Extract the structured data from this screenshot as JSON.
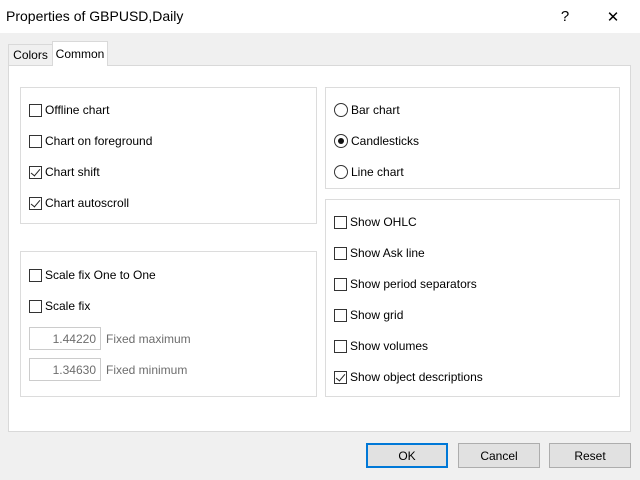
{
  "window": {
    "title": "Properties of GBPUSD,Daily",
    "help_glyph": "?",
    "close_glyph": "✕"
  },
  "tabs": [
    {
      "label": "Colors",
      "active": false
    },
    {
      "label": "Common",
      "active": true
    }
  ],
  "options": {
    "offline_chart": {
      "label": "Offline chart",
      "checked": false
    },
    "chart_on_foreground": {
      "label": "Chart on foreground",
      "checked": false
    },
    "chart_shift": {
      "label": "Chart shift",
      "checked": true
    },
    "chart_autoscroll": {
      "label": "Chart autoscroll",
      "checked": true
    }
  },
  "scale": {
    "scale_fix_one_to_one": {
      "label": "Scale fix One to One",
      "checked": false
    },
    "scale_fix": {
      "label": "Scale fix",
      "checked": false
    },
    "fixed_maximum": {
      "value": "1.44220",
      "label": "Fixed maximum"
    },
    "fixed_minimum": {
      "value": "1.34630",
      "label": "Fixed minimum"
    }
  },
  "chart_type": {
    "selected": "Candlesticks",
    "options": [
      "Bar chart",
      "Candlesticks",
      "Line chart"
    ]
  },
  "show": {
    "ohlc": {
      "label": "Show OHLC",
      "checked": false
    },
    "ask_line": {
      "label": "Show Ask line",
      "checked": false
    },
    "period_separators": {
      "label": "Show period separators",
      "checked": false
    },
    "grid": {
      "label": "Show grid",
      "checked": false
    },
    "volumes": {
      "label": "Show volumes",
      "checked": false
    },
    "object_descriptions": {
      "label": "Show object descriptions",
      "checked": true
    }
  },
  "buttons": {
    "ok": "OK",
    "cancel": "Cancel",
    "reset": "Reset"
  }
}
